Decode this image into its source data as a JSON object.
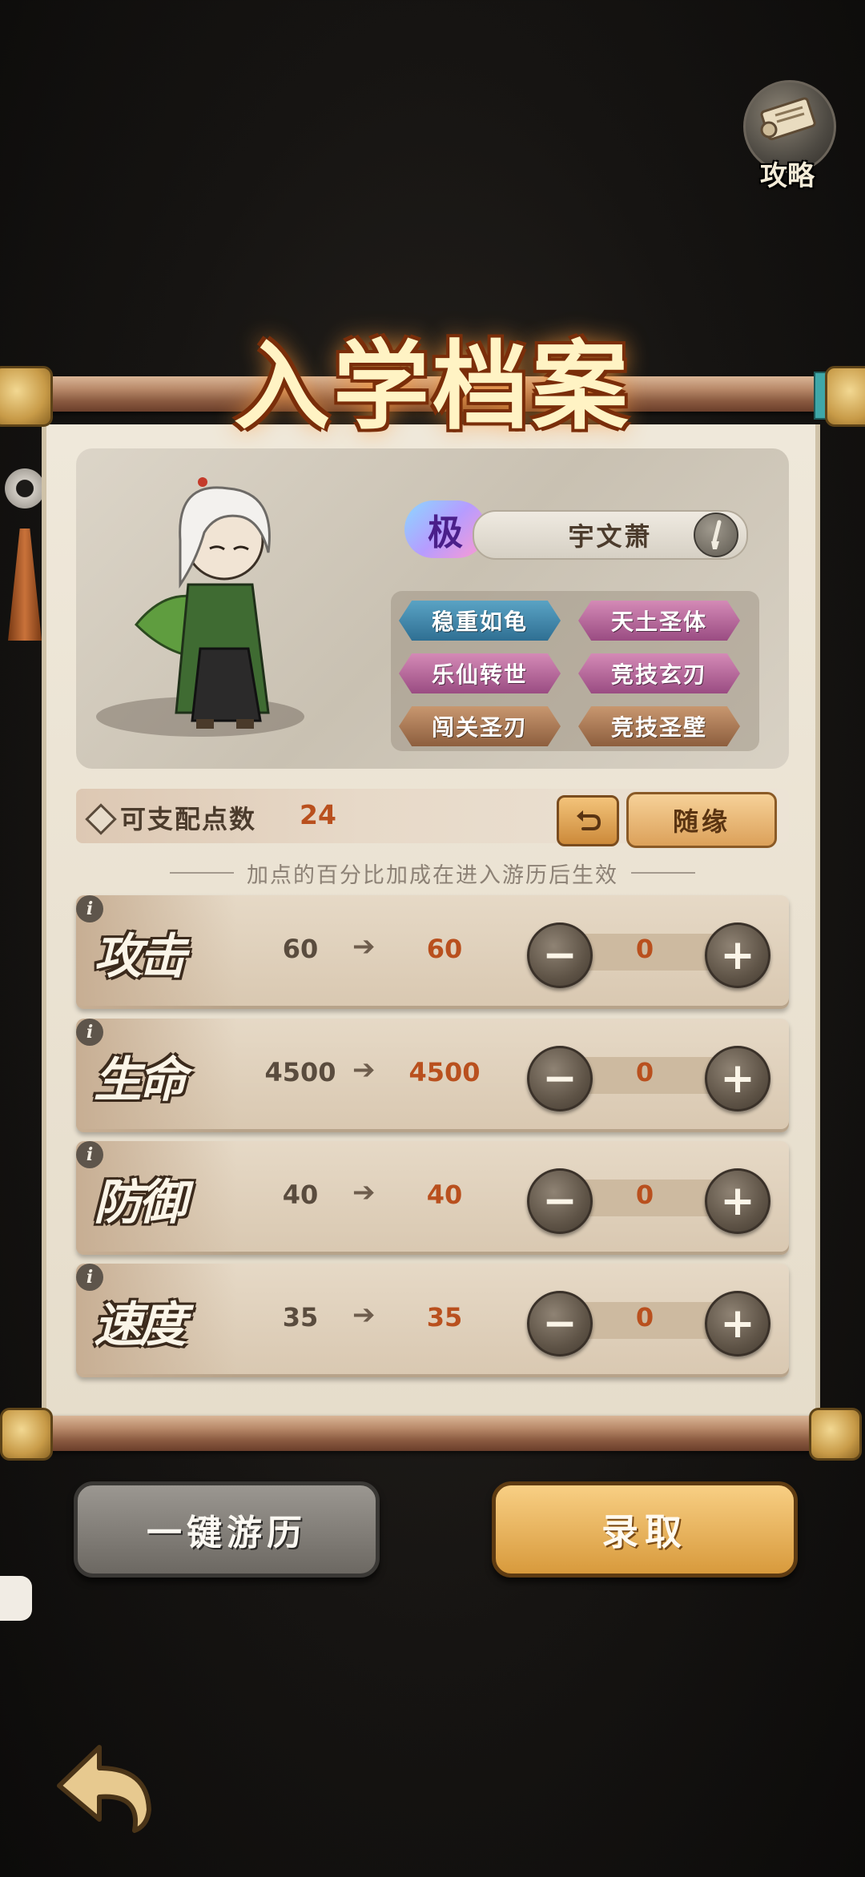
{
  "header": {
    "guide_label": "攻略"
  },
  "title": "入学档案",
  "character": {
    "grade": "极",
    "name": "宇文萧",
    "traits": [
      {
        "label": "稳重如龟",
        "color": "blue"
      },
      {
        "label": "天土圣体",
        "color": "pink"
      },
      {
        "label": "乐仙转世",
        "color": "pink"
      },
      {
        "label": "竞技玄刃",
        "color": "pink"
      },
      {
        "label": "闯关圣刃",
        "color": "brown"
      },
      {
        "label": "竞技圣壁",
        "color": "brown"
      }
    ]
  },
  "points": {
    "label": "可支配点数",
    "value": "24",
    "random_label": "随缘"
  },
  "hint": "加点的百分比加成在进入游历后生效",
  "stats": [
    {
      "name": "攻击",
      "base": "60",
      "final": "60",
      "alloc": "0"
    },
    {
      "name": "生命",
      "base": "4500",
      "final": "4500",
      "alloc": "0"
    },
    {
      "name": "防御",
      "base": "40",
      "final": "40",
      "alloc": "0"
    },
    {
      "name": "速度",
      "base": "35",
      "final": "35",
      "alloc": "0"
    }
  ],
  "buttons": {
    "travel": "一键游历",
    "admit": "录取"
  },
  "colors": {
    "accent_orange": "#b9501e",
    "paper": "#efe8da",
    "gold_button": "#f8cf84",
    "grey_button": "#9b9791"
  }
}
